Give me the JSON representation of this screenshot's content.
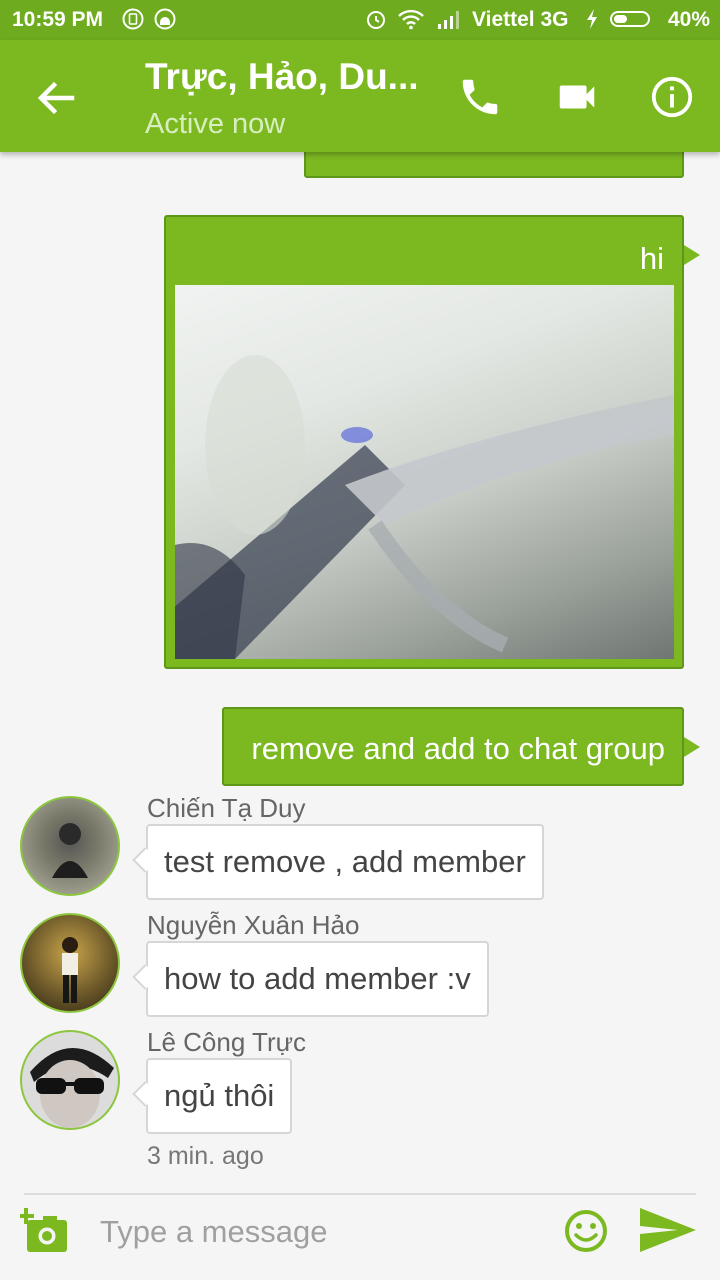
{
  "status_bar": {
    "time": "10:59 PM",
    "carrier": "Viettel 3G",
    "battery_percent": "40%",
    "battery_level": 0.4,
    "icons": [
      "sim-icon",
      "android-icon",
      "alarm-icon",
      "wifi-icon",
      "signal-icon",
      "charging-icon",
      "battery-icon"
    ]
  },
  "header": {
    "title": "Trực, Hảo, Du...",
    "subtitle": "Active now",
    "icons": [
      "back-arrow-icon",
      "phone-icon",
      "video-camera-icon",
      "info-icon"
    ]
  },
  "messages": {
    "outgoing": [
      {
        "text": "hi",
        "has_image": true
      },
      {
        "text": "remove and add to chat group"
      }
    ],
    "incoming": [
      {
        "sender": "Chiến Tạ Duy",
        "text": "test remove , add member"
      },
      {
        "sender": "Nguyễn Xuân Hảo",
        "text": "how to add member :v"
      },
      {
        "sender": "Lê Công Trực",
        "text": "ngủ thôi"
      }
    ],
    "last_timestamp": "3 min. ago"
  },
  "composer": {
    "placeholder": "Type a message",
    "value": "",
    "icons": [
      "add-photo-icon",
      "emoji-icon",
      "send-icon"
    ]
  },
  "colors": {
    "status_bar": "#6eab1f",
    "app_bar": "#7cb921",
    "outgoing_bubble": "#7cb921",
    "incoming_bubble": "#ffffff",
    "accent": "#7cb921"
  }
}
